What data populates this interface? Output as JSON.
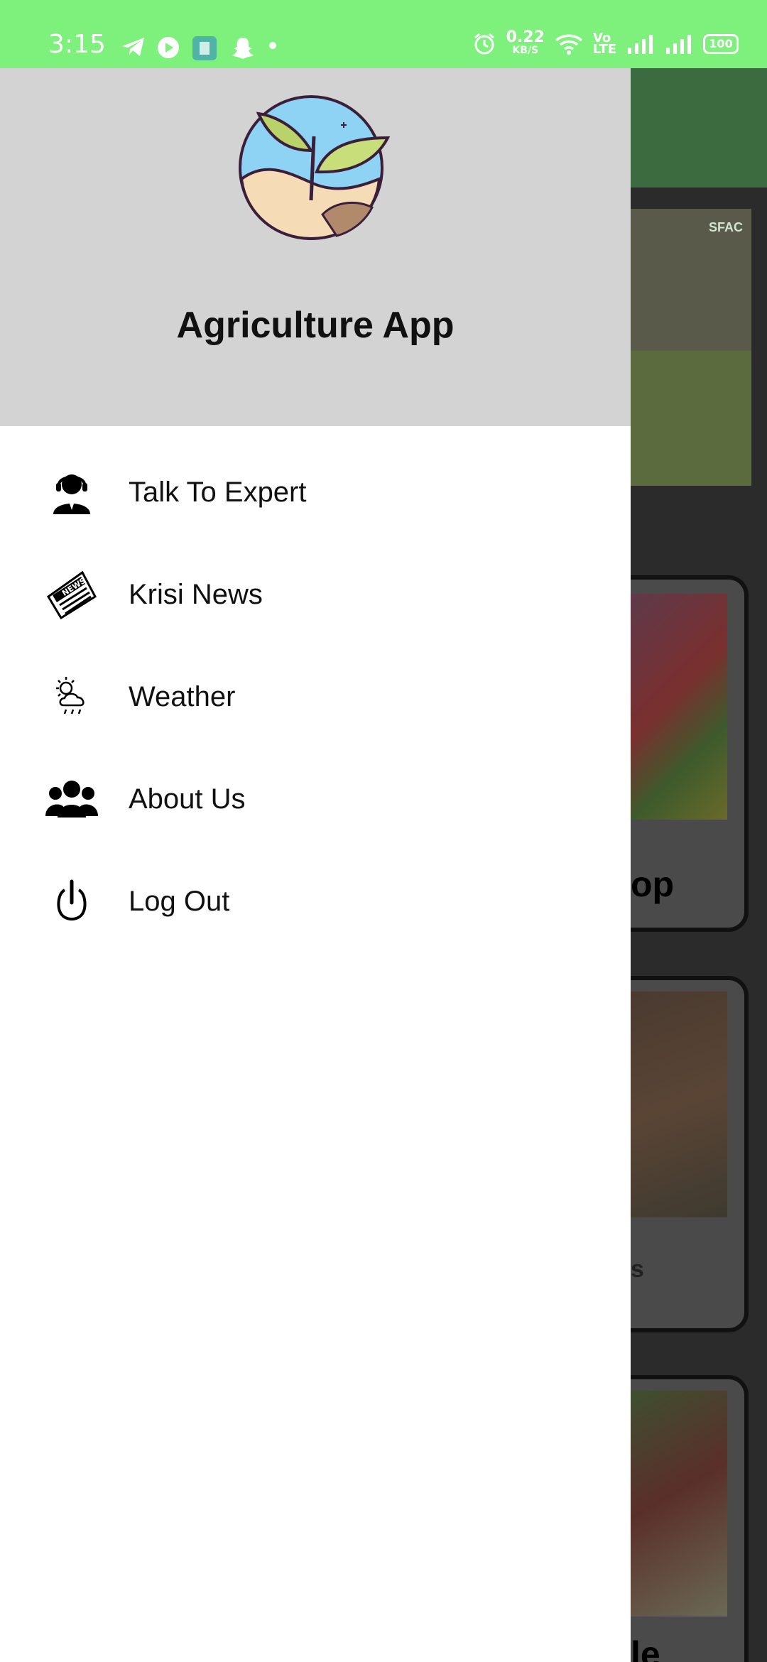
{
  "status_bar": {
    "time": "3:15",
    "speed_value": "0.22",
    "speed_unit": "KB/S",
    "volte_top": "Vo",
    "volte_bottom": "LTE",
    "battery": "100",
    "background_color": "#7ef07c"
  },
  "drawer": {
    "app_title": "Agriculture App",
    "header_color": "#d3d3d3",
    "items": [
      {
        "label": "Talk To Expert",
        "icon": "support-agent-icon"
      },
      {
        "label": "Krisi News",
        "icon": "newspaper-icon"
      },
      {
        "label": "Weather",
        "icon": "weather-icon"
      },
      {
        "label": "About Us",
        "icon": "group-icon"
      },
      {
        "label": "Log Out",
        "icon": "power-icon"
      }
    ]
  },
  "background_app": {
    "banner_logo": "SFAC",
    "card_texts": [
      "op",
      "s",
      "le"
    ]
  }
}
